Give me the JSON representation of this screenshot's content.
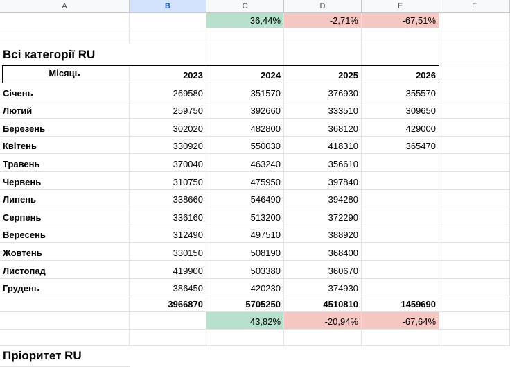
{
  "columns": [
    "A",
    "B",
    "C",
    "D",
    "E",
    "F"
  ],
  "selected_column": "B",
  "top_percent_row": [
    "",
    "",
    "36,44%",
    "-2,71%",
    "-67,51%",
    ""
  ],
  "section_title": "Всі категорії RU",
  "table": {
    "header": [
      "Місяць",
      "2023",
      "2024",
      "2025",
      "2026"
    ],
    "rows": [
      [
        "Січень",
        "269580",
        "351570",
        "376930",
        "355570"
      ],
      [
        "Лютий",
        "259750",
        "392660",
        "333510",
        "309650"
      ],
      [
        "Березень",
        "302020",
        "482800",
        "368120",
        "429000"
      ],
      [
        "Квітень",
        "330920",
        "550030",
        "418310",
        "365470"
      ],
      [
        "Травень",
        "370040",
        "463240",
        "356610",
        ""
      ],
      [
        "Червень",
        "310750",
        "475950",
        "397840",
        ""
      ],
      [
        "Липень",
        "338660",
        "546490",
        "394280",
        ""
      ],
      [
        "Серпень",
        "336160",
        "513200",
        "372290",
        ""
      ],
      [
        "Вересень",
        "312490",
        "497510",
        "388920",
        ""
      ],
      [
        "Жовтень",
        "330150",
        "508190",
        "368400",
        ""
      ],
      [
        "Листопад",
        "419900",
        "503380",
        "360670",
        ""
      ],
      [
        "Грудень",
        "386450",
        "420230",
        "374930",
        ""
      ]
    ],
    "totals": [
      "",
      "3966870",
      "5705250",
      "4510810",
      "1459690"
    ],
    "percent_row": [
      "",
      "",
      "43,82%",
      "-20,94%",
      "-67,64%"
    ]
  },
  "next_section_title": "Пріоритет RU",
  "colors": {
    "positive": "#b7e1cd",
    "negative": "#f4c7c3",
    "selected_header": "#d3e3fd"
  }
}
